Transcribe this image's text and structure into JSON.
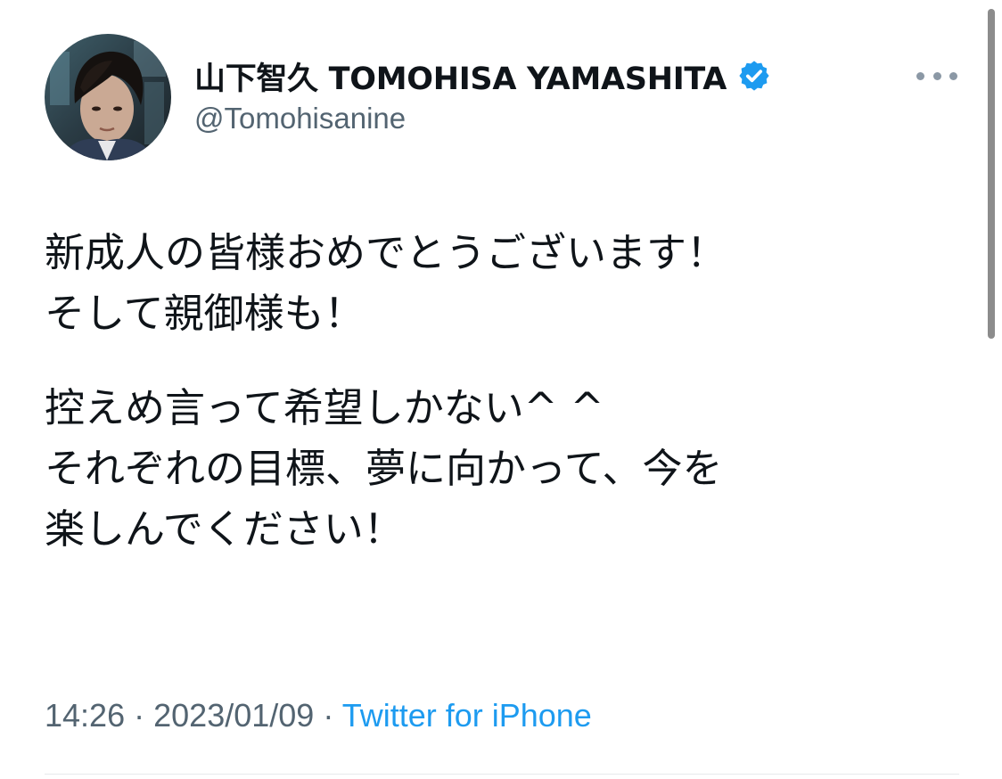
{
  "tweet": {
    "author": {
      "display_name": "山下智久 TOMOHISA YAMASHITA",
      "handle": "@Tomohisanine",
      "verified": true,
      "avatar_icon": "profile-photo"
    },
    "more_icon": "more-options-icon",
    "body_paragraphs": [
      [
        "新成人の皆様おめでとうございます！",
        "そして親御様も！"
      ],
      [
        "控えめ言って希望しかない^ ^",
        "それぞれの目標、夢に向かって、今を",
        "楽しんでください！"
      ]
    ],
    "time": "14:26",
    "date": "2023/01/09",
    "separator": "·",
    "source": "Twitter for iPhone"
  },
  "colors": {
    "text_primary": "#0f1419",
    "text_secondary": "#536471",
    "accent": "#1d9bf0",
    "divider": "#e6e9eb"
  }
}
